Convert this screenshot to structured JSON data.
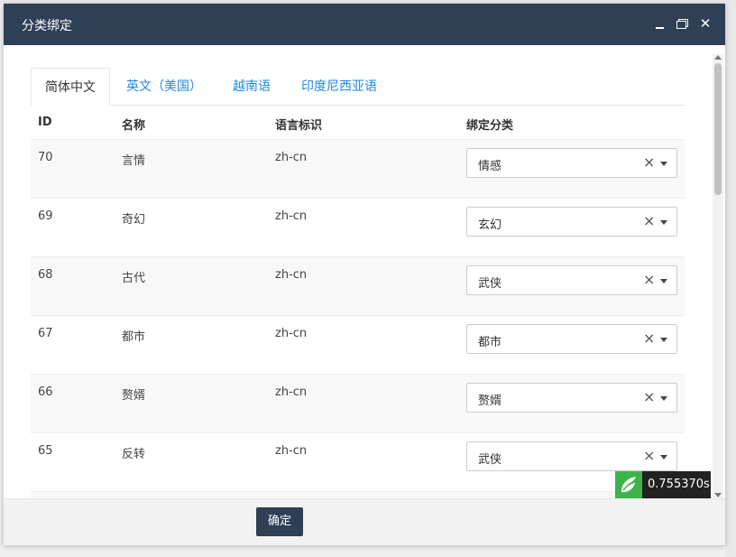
{
  "dialog": {
    "title": "分类绑定"
  },
  "tabs": [
    {
      "label": "简体中文",
      "active": true
    },
    {
      "label": "英文（美国）",
      "active": false
    },
    {
      "label": "越南语",
      "active": false
    },
    {
      "label": "印度尼西亚语",
      "active": false
    }
  ],
  "table": {
    "headers": {
      "id": "ID",
      "name": "名称",
      "lang": "语言标识",
      "bind": "绑定分类"
    },
    "rows": [
      {
        "id": "70",
        "name": "言情",
        "lang": "zh-cn",
        "category": "情感"
      },
      {
        "id": "69",
        "name": "奇幻",
        "lang": "zh-cn",
        "category": "玄幻"
      },
      {
        "id": "68",
        "name": "古代",
        "lang": "zh-cn",
        "category": "武侠"
      },
      {
        "id": "67",
        "name": "都市",
        "lang": "zh-cn",
        "category": "都市"
      },
      {
        "id": "66",
        "name": "赘婿",
        "lang": "zh-cn",
        "category": "赘婿"
      },
      {
        "id": "65",
        "name": "反转",
        "lang": "zh-cn",
        "category": "武侠"
      }
    ]
  },
  "footer": {
    "confirm_label": "确定"
  },
  "timer": {
    "value": "0.755370s"
  },
  "colors": {
    "titlebar": "#2f4056",
    "tab_link": "#1e88e5",
    "logo": "#3bb54a"
  }
}
